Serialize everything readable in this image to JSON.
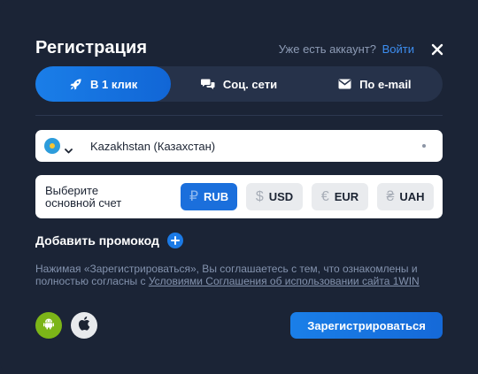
{
  "header": {
    "title": "Регистрация",
    "have_account_text": "Уже есть аккаунт?",
    "login_link": "Войти",
    "close_icon": "close-icon"
  },
  "tabs": [
    {
      "label": "В 1 клик",
      "icon": "rocket-icon",
      "active": true
    },
    {
      "label": "Соц. сети",
      "icon": "chat-bubbles-icon",
      "active": false
    },
    {
      "label": "По e-mail",
      "icon": "envelope-icon",
      "active": false
    }
  ],
  "country": {
    "value": "Kazakhstan (Казахстан)",
    "flag_icon": "kazakhstan-flag-icon"
  },
  "currency": {
    "label": "Выберите основной счет",
    "options": [
      {
        "code": "RUB",
        "symbol": "₽",
        "selected": true
      },
      {
        "code": "USD",
        "symbol": "$",
        "selected": false
      },
      {
        "code": "EUR",
        "symbol": "€",
        "selected": false
      },
      {
        "code": "UAH",
        "symbol": "₴",
        "selected": false
      }
    ]
  },
  "promo": {
    "label": "Добавить промокод",
    "icon": "plus-icon"
  },
  "terms": {
    "text": "Нажимая «Зарегистрироваться», Вы соглашаетесь с тем, что ознакомлены и полностью согласны с ",
    "link": "Условиями Соглашения об использовании сайта 1WIN"
  },
  "apps": [
    {
      "icon": "android-icon"
    },
    {
      "icon": "apple-icon"
    }
  ],
  "register_button": "Зарегистрироваться",
  "colors": {
    "background": "#1b2436",
    "accent": "#1b7ae6",
    "tab_bg": "#26324a",
    "link": "#3d8ef0",
    "android": "#7cb518"
  }
}
